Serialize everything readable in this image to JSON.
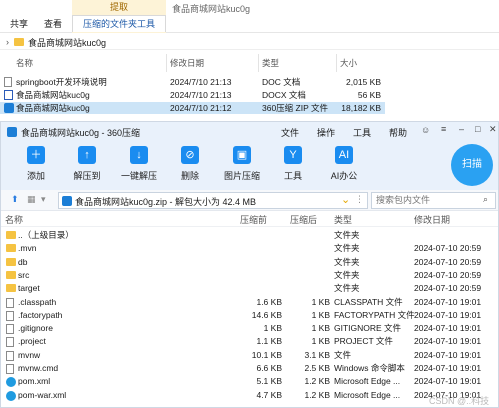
{
  "explorer": {
    "context_tab": "提取",
    "window_title": "食品商城网站kuc0g",
    "tabs": [
      "共享",
      "查看"
    ],
    "tools_tab": "压缩的文件夹工具",
    "breadcrumb": "食品商城网站kuc0g",
    "columns": [
      "名称",
      "修改日期",
      "类型",
      "大小"
    ],
    "files": [
      {
        "name": "springboot开发环境说明",
        "date": "2024/7/10 21:13",
        "type": "DOC 文档",
        "size": "2,015 KB",
        "icon": "doc-icon"
      },
      {
        "name": "食品商城网站kuc0g",
        "date": "2024/7/10 21:13",
        "type": "DOCX 文档",
        "size": "56 KB",
        "icon": "word-icon"
      },
      {
        "name": "食品商城网站kuc0g",
        "date": "2024/7/10 21:12",
        "type": "360压缩 ZIP 文件",
        "size": "18,182 KB",
        "icon": "zip-icon"
      }
    ]
  },
  "zip360": {
    "title": "食品商城网站kuc0g - 360压缩",
    "menus": [
      "文件",
      "操作",
      "工具",
      "帮助"
    ],
    "toolbar": [
      "添加",
      "解压到",
      "一键解压",
      "删除",
      "图片压缩",
      "工具",
      "AI办公"
    ],
    "scan_label": "扫描",
    "path": "食品商城网站kuc0g.zip - 解包大小为 42.4 MB",
    "search_placeholder": "搜索包内文件",
    "columns": [
      "名称",
      "压缩前",
      "压缩后",
      "类型",
      "修改日期"
    ],
    "rows": [
      {
        "name": "..（上级目录）",
        "before": "",
        "after": "",
        "type": "文件夹",
        "date": "",
        "icon": "folder"
      },
      {
        "name": ".mvn",
        "before": "",
        "after": "",
        "type": "文件夹",
        "date": "2024-07-10 20:59",
        "icon": "folder"
      },
      {
        "name": "db",
        "before": "",
        "after": "",
        "type": "文件夹",
        "date": "2024-07-10 20:59",
        "icon": "folder"
      },
      {
        "name": "src",
        "before": "",
        "after": "",
        "type": "文件夹",
        "date": "2024-07-10 20:59",
        "icon": "folder"
      },
      {
        "name": "target",
        "before": "",
        "after": "",
        "type": "文件夹",
        "date": "2024-07-10 20:59",
        "icon": "folder"
      },
      {
        "name": ".classpath",
        "before": "1.6 KB",
        "after": "1 KB",
        "type": "CLASSPATH 文件",
        "date": "2024-07-10 19:01",
        "icon": "doc"
      },
      {
        "name": ".factorypath",
        "before": "14.6 KB",
        "after": "1 KB",
        "type": "FACTORYPATH 文件",
        "date": "2024-07-10 19:01",
        "icon": "doc"
      },
      {
        "name": ".gitignore",
        "before": "1 KB",
        "after": "1 KB",
        "type": "GITIGNORE 文件",
        "date": "2024-07-10 19:01",
        "icon": "doc"
      },
      {
        "name": ".project",
        "before": "1.1 KB",
        "after": "1 KB",
        "type": "PROJECT 文件",
        "date": "2024-07-10 19:01",
        "icon": "doc"
      },
      {
        "name": "mvnw",
        "before": "10.1 KB",
        "after": "3.1 KB",
        "type": "文件",
        "date": "2024-07-10 19:01",
        "icon": "doc"
      },
      {
        "name": "mvnw.cmd",
        "before": "6.6 KB",
        "after": "2.5 KB",
        "type": "Windows 命令脚本",
        "date": "2024-07-10 19:01",
        "icon": "doc"
      },
      {
        "name": "pom.xml",
        "before": "5.1 KB",
        "after": "1.2 KB",
        "type": "Microsoft Edge ...",
        "date": "2024-07-10 19:01",
        "icon": "edge"
      },
      {
        "name": "pom-war.xml",
        "before": "4.7 KB",
        "after": "1.2 KB",
        "type": "Microsoft Edge ...",
        "date": "2024-07-10 19:01",
        "icon": "edge"
      }
    ]
  },
  "watermark": "CSDN @..科技"
}
